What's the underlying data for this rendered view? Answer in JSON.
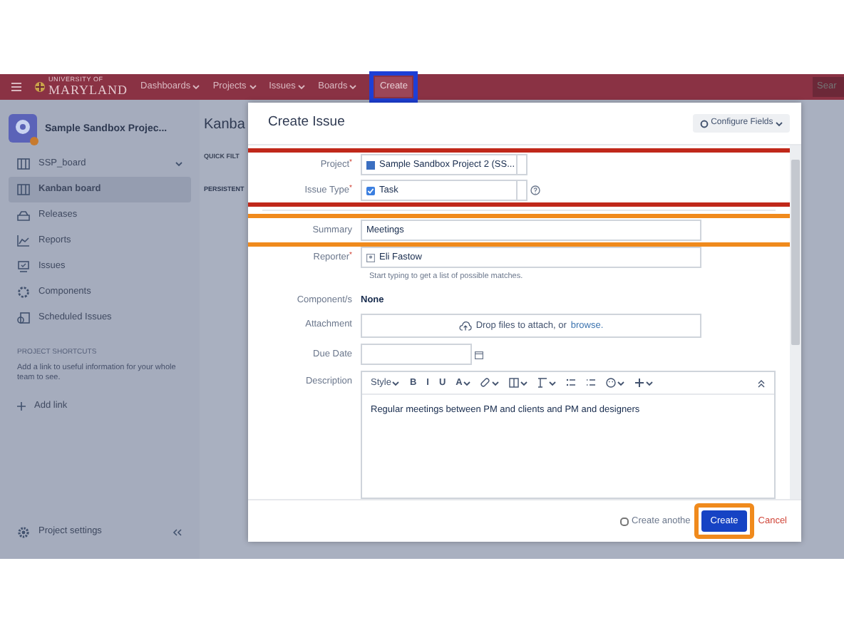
{
  "top_nav": {
    "logo": {
      "small": "UNIVERSITY OF",
      "large": "MARYLAND"
    },
    "items": [
      {
        "label": "Dashboards",
        "kind": "menu"
      },
      {
        "label": "Projects",
        "kind": "menu"
      },
      {
        "label": "Issues",
        "kind": "menu"
      },
      {
        "label": "Boards",
        "kind": "menu"
      },
      {
        "label": "Create",
        "kind": "button",
        "color": "#1d3fd6"
      }
    ],
    "search": {
      "placeholder": "Sear"
    }
  },
  "sidebar": {
    "project_name": "Sample Sandbox Projec...",
    "board": "SSP_board",
    "items": [
      {
        "label": "Kanban board",
        "selected": true
      },
      {
        "label": "Releases",
        "selected": false
      },
      {
        "label": "Reports",
        "selected": false
      },
      {
        "label": "Issues",
        "selected": false
      },
      {
        "label": "Components",
        "selected": false
      },
      {
        "label": "Scheduled Issues",
        "selected": false
      }
    ],
    "shortcuts_heading": "PROJECT SHORTCUTS",
    "shortcuts_text": "Add a link to useful information for your whole team to see.",
    "add_link": "Add link",
    "settings": "Project settings"
  },
  "main": {
    "title": "Kanba",
    "quick_filters": "QUICK FILT",
    "persistent": "PERSISTENT"
  },
  "dialog": {
    "title": "Create Issue",
    "configure_button": "Configure Fields",
    "fields": [
      {
        "kind": "select",
        "label": "Project",
        "required_mark": "*",
        "value": "Sample Sandbox Project 2 (SS...",
        "color": "#c0281a"
      },
      {
        "kind": "select",
        "label": "Issue Type",
        "required_mark": "*",
        "value": "Task",
        "help": true,
        "color": "#c0281a"
      },
      {
        "kind": "divider"
      },
      {
        "kind": "text",
        "label": "Summary",
        "value": "Meetings",
        "color": "#f08a1c"
      },
      {
        "kind": "user",
        "label": "Reporter",
        "required_mark": "*",
        "value": "Eli Fastow",
        "hint": "Start typing to get a list of possible matches."
      },
      {
        "kind": "static",
        "label": "Component/s",
        "value": "None"
      },
      {
        "kind": "attachment",
        "label": "Attachment",
        "value": "Drop files to attach, or",
        "link": "browse."
      },
      {
        "kind": "date",
        "label": "Due Date"
      },
      {
        "kind": "editor",
        "label": "Description",
        "value": "Regular meetings between PM and clients and PM and designers",
        "toolbar": [
          {
            "kind": "text",
            "label": "Style",
            "dropdown": true
          },
          {
            "kind": "text",
            "label": "B"
          },
          {
            "kind": "text",
            "label": "I"
          },
          {
            "kind": "text",
            "label": "U"
          },
          {
            "kind": "text",
            "label": "A",
            "dropdown": true
          },
          {
            "kind": "icon",
            "dropdown": true
          },
          {
            "kind": "icon",
            "dropdown": true
          },
          {
            "kind": "icon",
            "dropdown": true
          },
          {
            "kind": "icon"
          },
          {
            "kind": "icon"
          },
          {
            "kind": "icon",
            "dropdown": true
          },
          {
            "kind": "icon",
            "dropdown": true
          }
        ]
      }
    ],
    "footer": {
      "checkbox_label": "Create anothe",
      "checked": false,
      "create": "Create",
      "color": "#f08a1c",
      "cancel": "Cancel"
    }
  }
}
